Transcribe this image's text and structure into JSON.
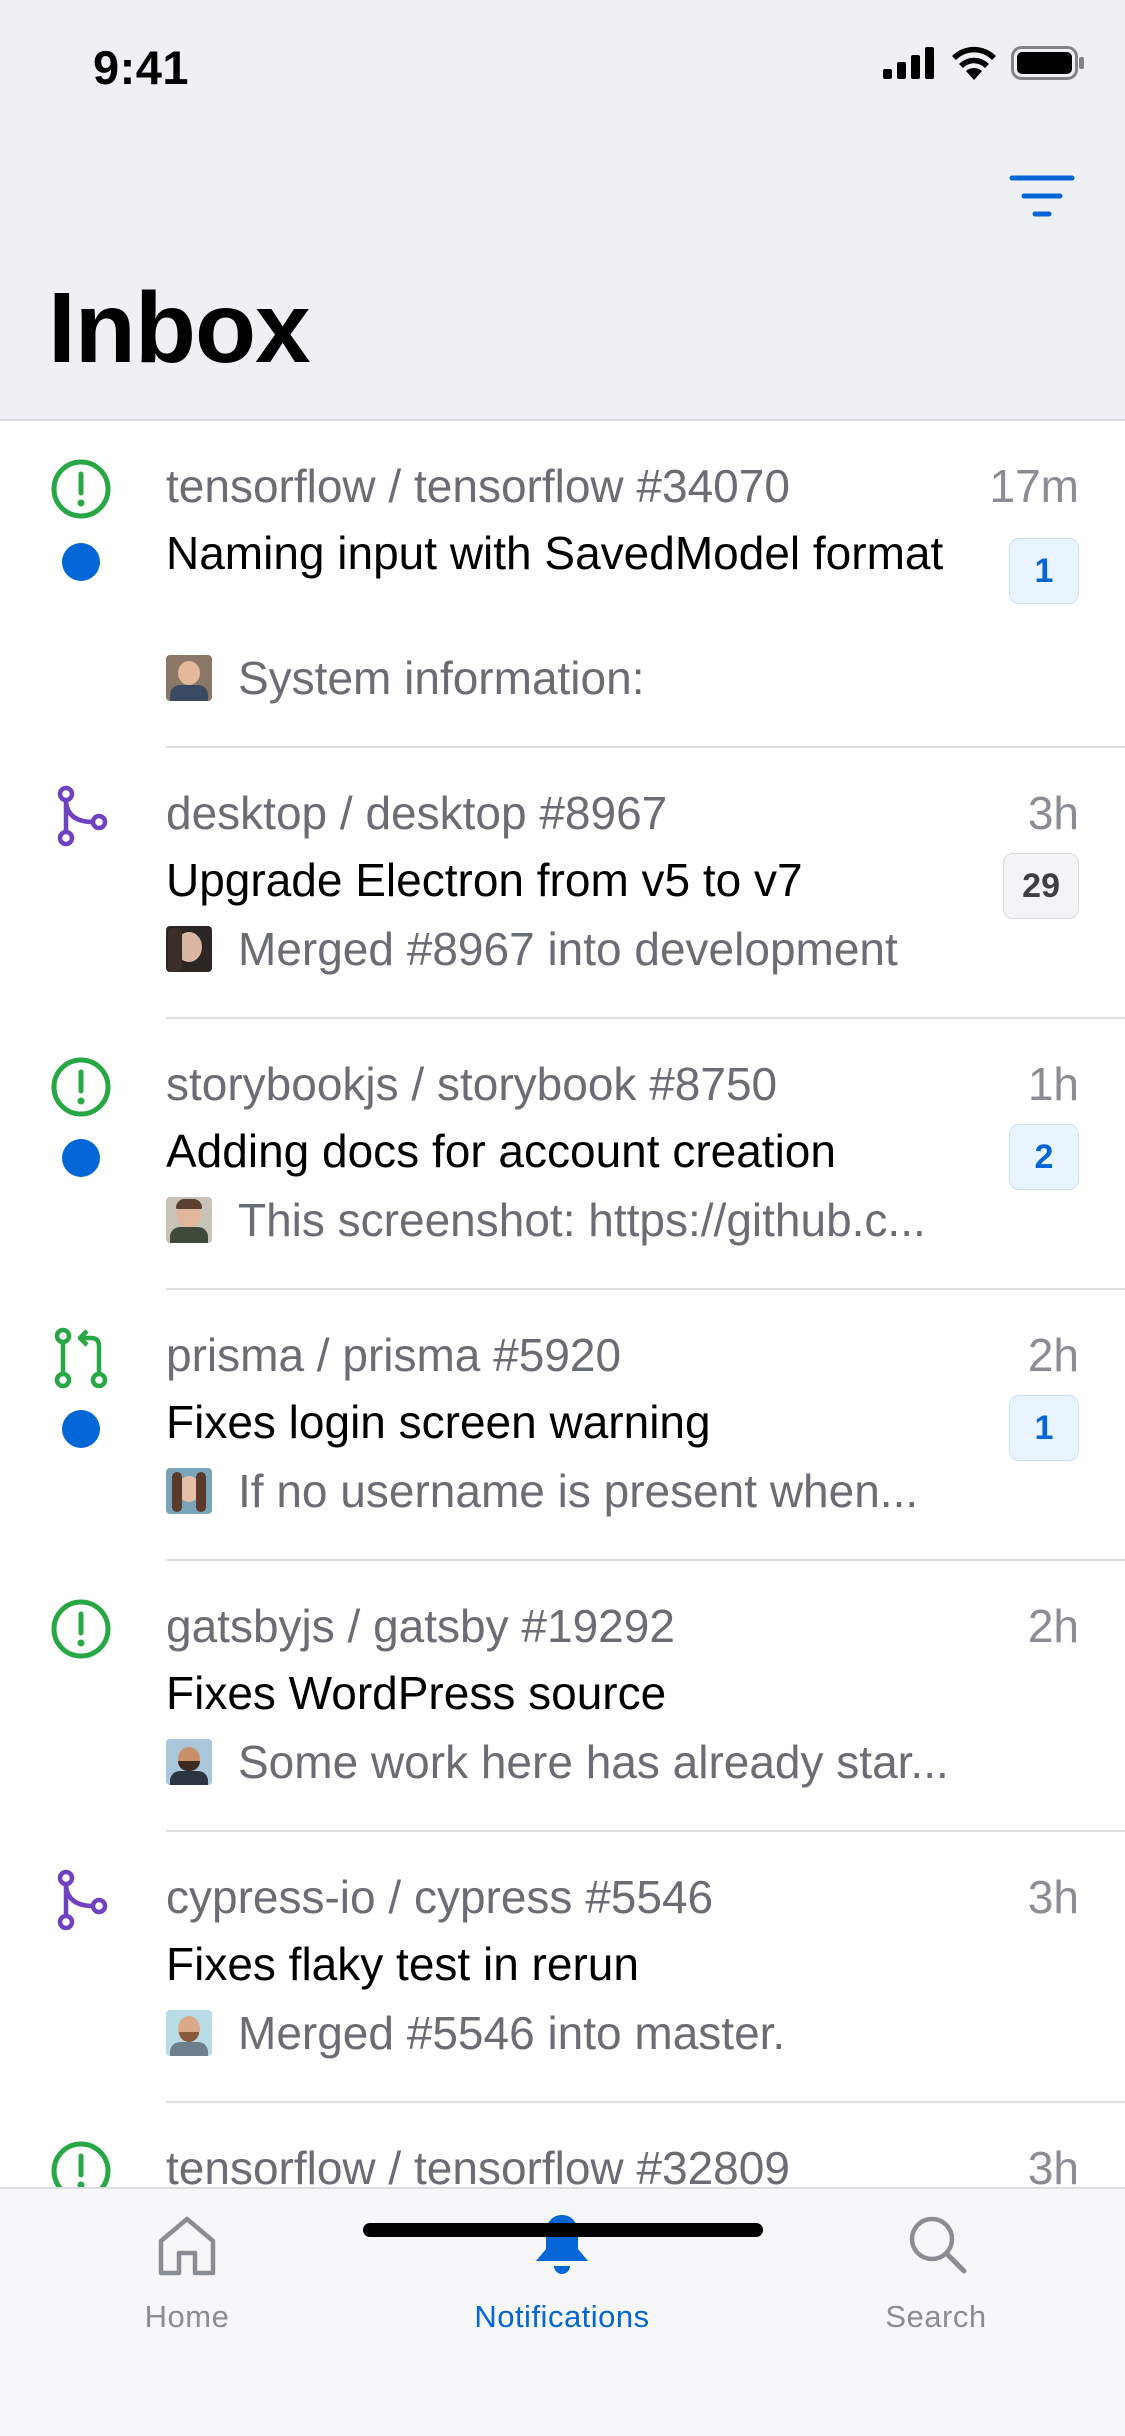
{
  "status_bar": {
    "time": "9:41"
  },
  "header": {
    "title": "Inbox",
    "filter_icon": "filter-icon"
  },
  "notifications": [
    {
      "type": "issue-open",
      "unread": true,
      "repo": "tensorflow / tensorflow #34070",
      "time": "17m",
      "subject": "Naming input with SavedModel format",
      "badge": "1",
      "badge_style": "blue",
      "comment": "System information:"
    },
    {
      "type": "pr-merged",
      "unread": false,
      "repo": "desktop / desktop #8967",
      "time": "3h",
      "subject": "Upgrade Electron from v5 to v7",
      "badge": "29",
      "badge_style": "gray",
      "comment": "Merged #8967 into development"
    },
    {
      "type": "issue-open",
      "unread": true,
      "repo": "storybookjs / storybook #8750",
      "time": "1h",
      "subject": "Adding docs for account creation",
      "badge": "2",
      "badge_style": "blue",
      "comment": "This screenshot: https://github.c..."
    },
    {
      "type": "pr-open",
      "unread": true,
      "repo": "prisma / prisma #5920",
      "time": "2h",
      "subject": "Fixes login screen warning",
      "badge": "1",
      "badge_style": "blue",
      "comment": "If no username is present when..."
    },
    {
      "type": "issue-open",
      "unread": false,
      "repo": "gatsbyjs / gatsby #19292",
      "time": "2h",
      "subject": "Fixes WordPress source",
      "badge": "",
      "badge_style": "",
      "comment": "Some work here has already star..."
    },
    {
      "type": "pr-merged",
      "unread": false,
      "repo": "cypress-io / cypress #5546",
      "time": "3h",
      "subject": "Fixes flaky test in rerun",
      "badge": "",
      "badge_style": "",
      "comment": "Merged #5546 into master."
    },
    {
      "type": "issue-open",
      "unread": false,
      "repo": "tensorflow / tensorflow #32809",
      "time": "3h",
      "subject": "",
      "badge": "",
      "badge_style": "",
      "comment": ""
    }
  ],
  "tabs": [
    {
      "label": "Home",
      "icon": "home-icon",
      "active": false
    },
    {
      "label": "Notifications",
      "icon": "bell-icon",
      "active": true
    },
    {
      "label": "Search",
      "icon": "search-icon",
      "active": false
    }
  ],
  "colors": {
    "accent": "#0366d6",
    "issue_green": "#28a745",
    "merged_purple": "#6f42c1",
    "muted": "#8a8d93"
  }
}
